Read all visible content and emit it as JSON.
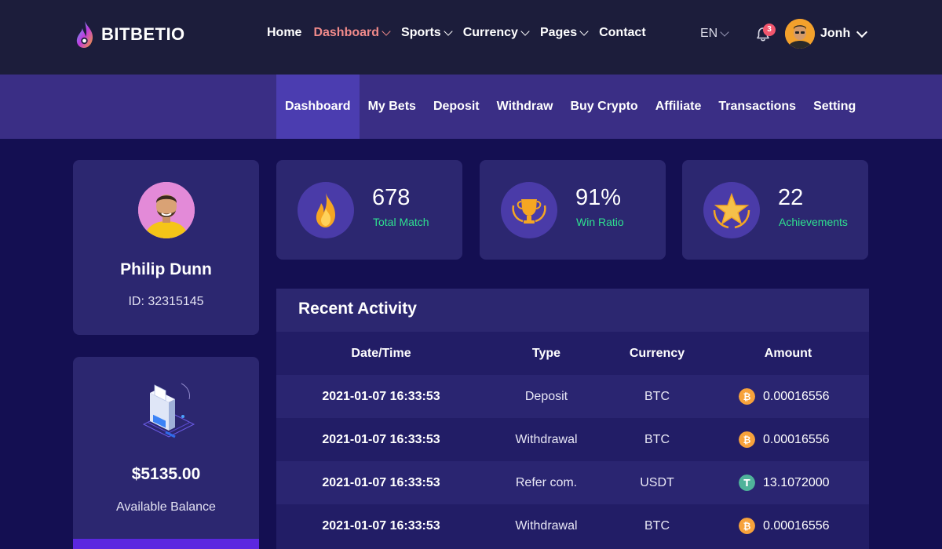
{
  "brand": {
    "name": "BITBETIO"
  },
  "main_nav": [
    {
      "label": "Home",
      "dropdown": false,
      "active": false
    },
    {
      "label": "Dashboard",
      "dropdown": true,
      "active": true
    },
    {
      "label": "Sports",
      "dropdown": true,
      "active": false
    },
    {
      "label": "Currency",
      "dropdown": true,
      "active": false
    },
    {
      "label": "Pages",
      "dropdown": true,
      "active": false
    },
    {
      "label": "Contact",
      "dropdown": false,
      "active": false
    }
  ],
  "language": "EN",
  "notifications": {
    "count": "3",
    "icon": "bell-icon"
  },
  "user": {
    "name": "Jonh"
  },
  "sub_nav": [
    {
      "label": "Dashboard",
      "active": true
    },
    {
      "label": "My Bets",
      "active": false
    },
    {
      "label": "Deposit",
      "active": false
    },
    {
      "label": "Withdraw",
      "active": false
    },
    {
      "label": "Buy Crypto",
      "active": false
    },
    {
      "label": "Affiliate",
      "active": false
    },
    {
      "label": "Transactions",
      "active": false
    },
    {
      "label": "Setting",
      "active": false
    }
  ],
  "profile": {
    "name": "Philip Dunn",
    "id_text": "ID: 32315145"
  },
  "balance": {
    "amount": "$5135.00",
    "label": "Available Balance"
  },
  "stats": [
    {
      "value": "678",
      "label": "Total Match",
      "icon": "fire-icon"
    },
    {
      "value": "91%",
      "label": "Win Ratio",
      "icon": "trophy-icon"
    },
    {
      "value": "22",
      "label": "Achievements",
      "icon": "star-badge-icon"
    }
  ],
  "activity": {
    "title": "Recent Activity",
    "columns": [
      "Date/Time",
      "Type",
      "Currency",
      "Amount"
    ],
    "rows": [
      {
        "datetime": "2021-01-07 16:33:53",
        "type": "Deposit",
        "currency": "BTC",
        "amount": "0.00016556",
        "coin_icon": "bitcoin-icon"
      },
      {
        "datetime": "2021-01-07 16:33:53",
        "type": "Withdrawal",
        "currency": "BTC",
        "amount": "0.00016556",
        "coin_icon": "bitcoin-icon"
      },
      {
        "datetime": "2021-01-07 16:33:53",
        "type": "Refer com.",
        "currency": "USDT",
        "amount": "13.1072000",
        "coin_icon": "tether-icon"
      },
      {
        "datetime": "2021-01-07 16:33:53",
        "type": "Withdrawal",
        "currency": "BTC",
        "amount": "0.00016556",
        "coin_icon": "bitcoin-icon"
      }
    ]
  },
  "colors": {
    "background": "#140f52",
    "topbar": "#1c1d3b",
    "subnav": "#3a2e85",
    "card": "#2c2770",
    "accent_green": "#2fe08f",
    "active_nav": "#f08a8a",
    "bitcoin": "#f7a23b",
    "tether": "#4fb39a"
  }
}
